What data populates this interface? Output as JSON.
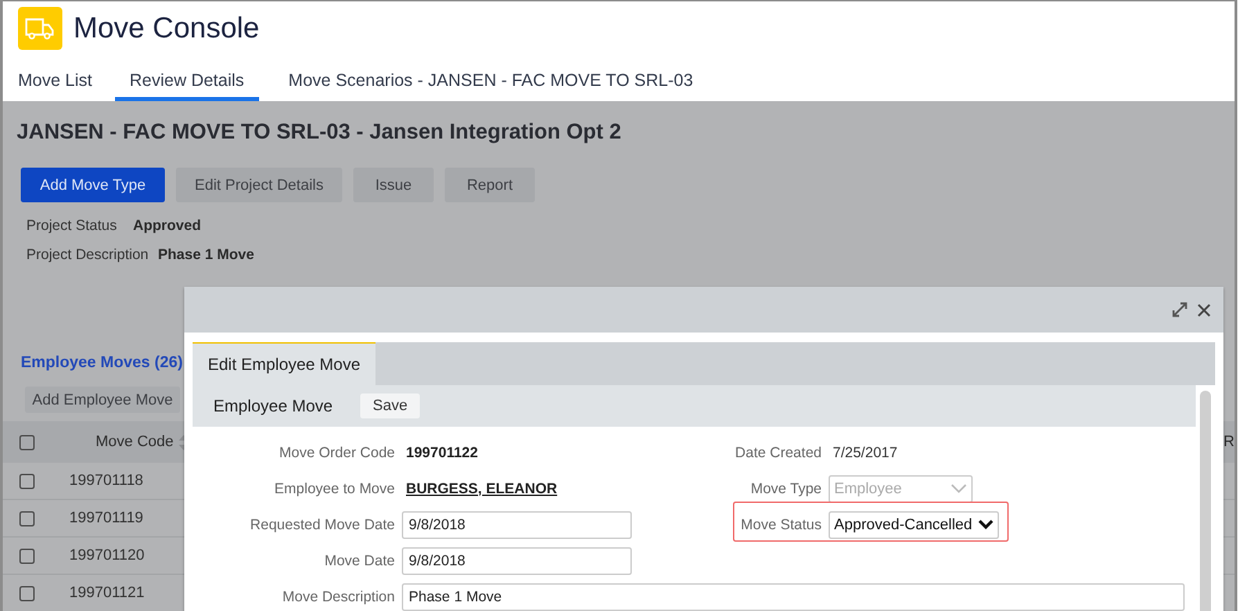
{
  "app": {
    "title": "Move Console"
  },
  "tabs": [
    {
      "label": "Move List",
      "selected": false
    },
    {
      "label": "Review Details",
      "selected": true
    },
    {
      "label": "Move Scenarios - JANSEN - FAC MOVE TO SRL-03",
      "selected": false
    }
  ],
  "project": {
    "title": "JANSEN - FAC MOVE TO SRL-03 - Jansen Integration Opt 2",
    "buttons": [
      {
        "label": "Add Move Type",
        "kind": "primary"
      },
      {
        "label": "Edit Project Details",
        "kind": "secondary"
      },
      {
        "label": "Issue",
        "kind": "secondary"
      },
      {
        "label": "Report",
        "kind": "secondary"
      }
    ],
    "fields": [
      {
        "label": "Project Status",
        "value": "Approved"
      },
      {
        "label": "Project Description",
        "value": "Phase 1 Move"
      }
    ]
  },
  "employee_moves": {
    "heading": "Employee Moves (26)",
    "add_button": "Add Employee Move",
    "all_checked": false,
    "columns": [
      "Move Code",
      "R"
    ],
    "rows": [
      {
        "checked": false,
        "move_code": "199701118"
      },
      {
        "checked": false,
        "move_code": "199701119"
      },
      {
        "checked": false,
        "move_code": "199701120"
      },
      {
        "checked": false,
        "move_code": "199701121"
      }
    ]
  },
  "dialog": {
    "tabs": [
      {
        "label": "Edit Employee Move",
        "selected": true
      }
    ],
    "section": "Employee Move",
    "save_button": "Save",
    "left_fields": [
      {
        "kind": "text",
        "label": "Move Order Code",
        "value": "199701122"
      },
      {
        "kind": "link",
        "label": "Employee to Move",
        "value": "BURGESS, ELEANOR"
      },
      {
        "kind": "input",
        "label": "Requested Move Date",
        "value": "9/8/2018"
      },
      {
        "kind": "input",
        "label": "Move Date",
        "value": "9/8/2018"
      },
      {
        "kind": "wide_input",
        "label": "Move Description",
        "value": "Phase 1 Move"
      }
    ],
    "right_fields": [
      {
        "kind": "plain",
        "label": "Date Created",
        "value": "7/25/2017",
        "highlighted": false
      },
      {
        "kind": "select",
        "label": "Move Type",
        "value": "Employee",
        "disabled": true,
        "highlighted": false
      },
      {
        "kind": "select",
        "label": "Move Status",
        "value": "Approved-Cancelled",
        "disabled": false,
        "highlighted": true
      }
    ]
  }
}
